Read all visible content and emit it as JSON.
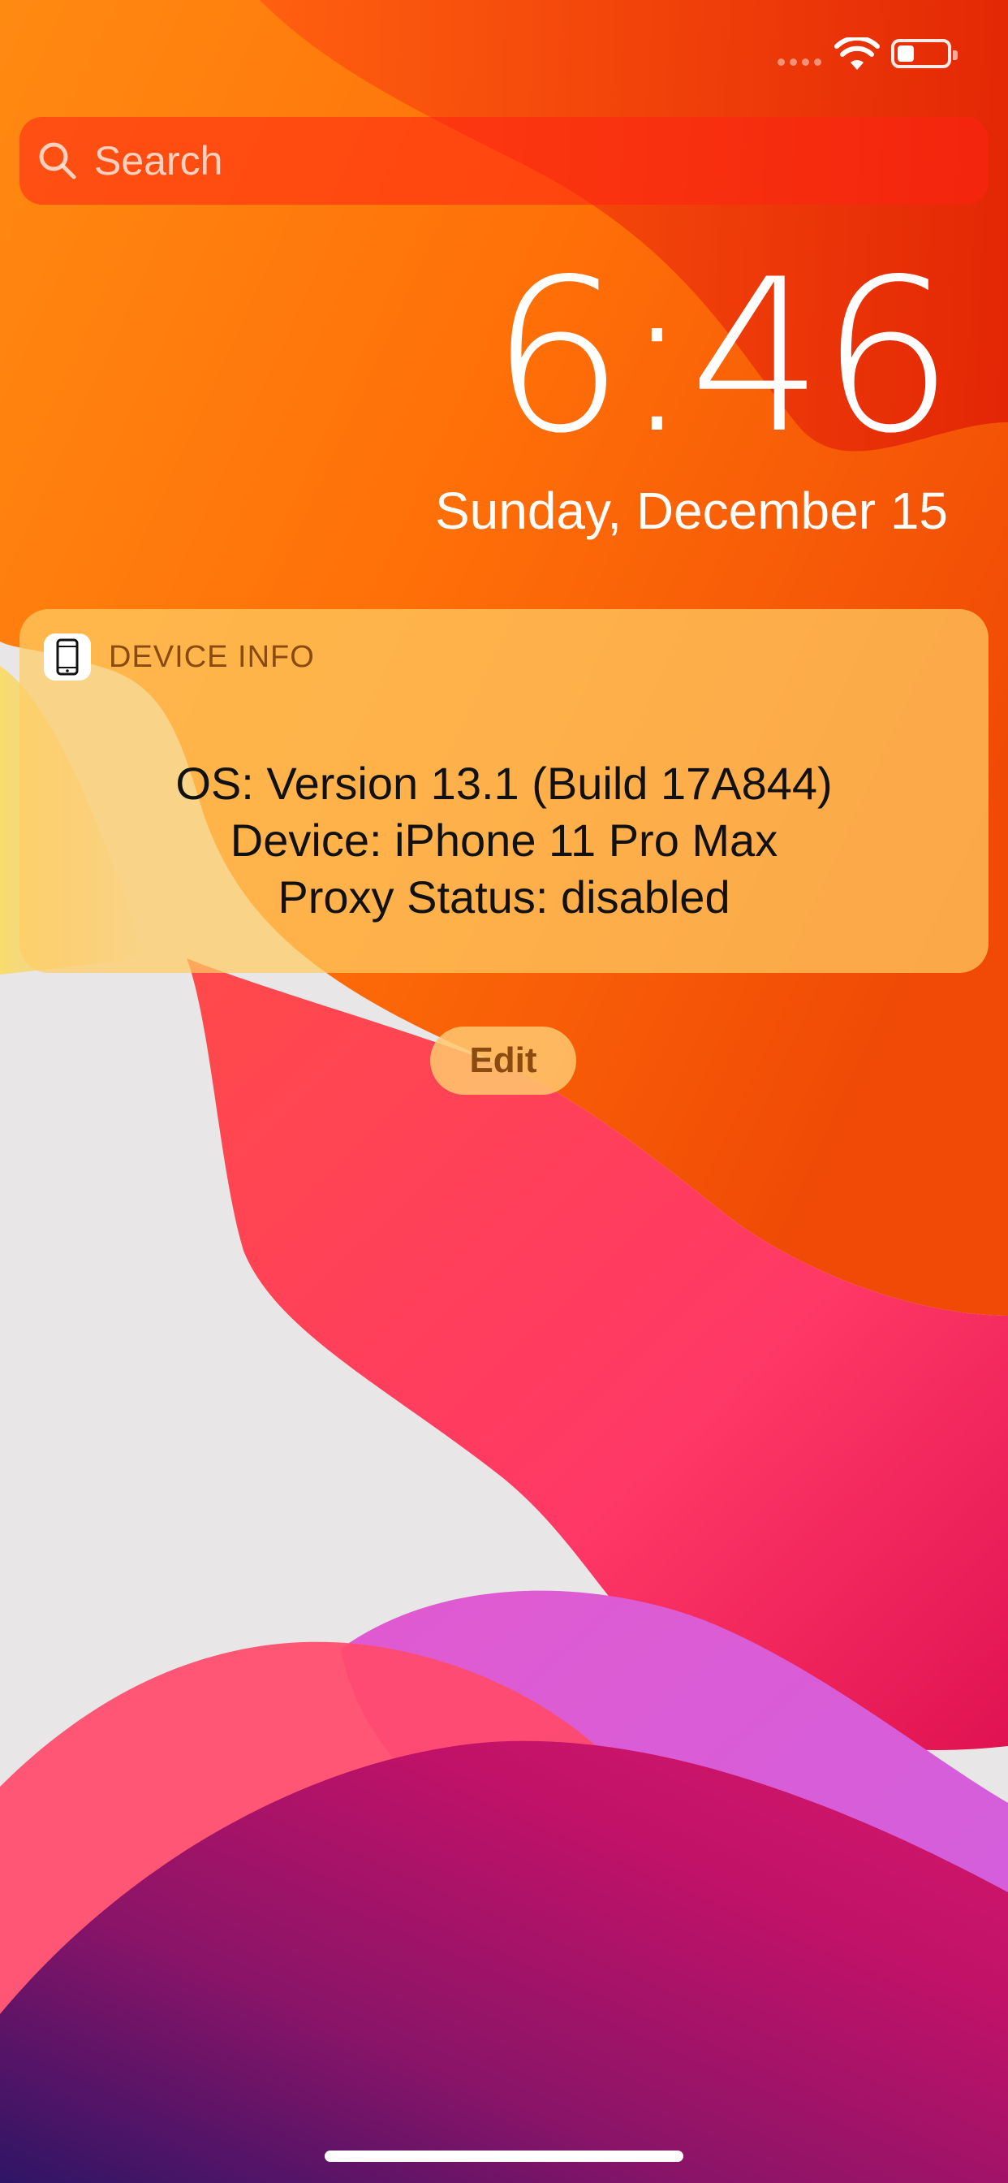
{
  "status_bar": {
    "signal_icon": "signal-dots-icon",
    "wifi_icon": "wifi-icon",
    "battery_icon": "battery-icon",
    "battery_level": 0.35
  },
  "search": {
    "icon": "search-icon",
    "placeholder": "Search"
  },
  "lock_screen": {
    "time": "6:46",
    "date": "Sunday, December 15"
  },
  "widget": {
    "app_icon": "phone-icon",
    "title": "DEVICE INFO",
    "lines": [
      "OS: Version 13.1 (Build 17A844)",
      "Device: iPhone 11 Pro Max",
      "Proxy Status: disabled"
    ]
  },
  "edit_button": {
    "label": "Edit"
  },
  "colors": {
    "wallpaper_orange": "#ff7a0a",
    "wallpaper_red": "#ff2d2d",
    "wallpaper_pink": "#ff3d6e",
    "wallpaper_magenta": "#c2186a",
    "wallpaper_purple": "#3a1a6e",
    "widget_bg": "#ffc864",
    "widget_title": "#8a4a10"
  }
}
